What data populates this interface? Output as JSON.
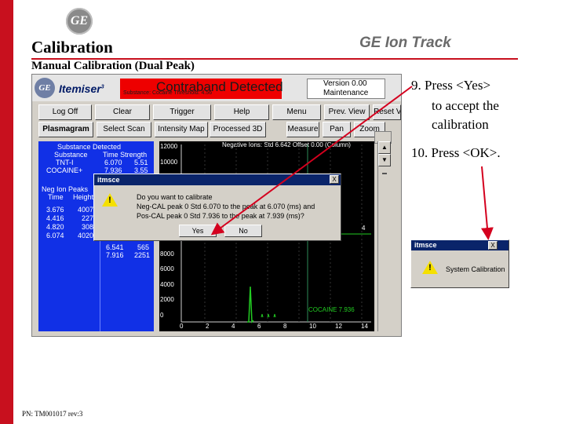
{
  "slide": {
    "logo_text": "GE",
    "title": "Calibration",
    "brand": "GE Ion Track",
    "subtitle": "Manual Calibration (Dual Peak)",
    "footer": "PN: TM001017 rev:3",
    "accent_color": "#c8101e"
  },
  "app": {
    "logo_text": "GE",
    "name": "Itemiser",
    "name_sup": "3",
    "alert_text": "Contraband Detected",
    "alert_subtext": "Substance: Cocaine Threshold: 4.56",
    "version_text": "Version 0.00",
    "mode_text": "Maintenance",
    "toolbar": [
      {
        "label": "Log Off",
        "left": 8,
        "width": 68
      },
      {
        "label": "Clear",
        "left": 80,
        "width": 70
      },
      {
        "label": "Trigger",
        "left": 154,
        "width": 74
      },
      {
        "label": "Help",
        "left": 232,
        "width": 70
      },
      {
        "label": "Menu",
        "left": 306,
        "width": 62
      },
      {
        "label": "Prev. View",
        "left": 372,
        "width": 58
      },
      {
        "label": "Reset View",
        "left": 434,
        "width": 36
      }
    ],
    "tabs": [
      {
        "label": "Plasmagram",
        "left": 8,
        "width": 70
      },
      {
        "label": "Select Scan",
        "left": 82,
        "width": 70
      },
      {
        "label": "Intensity Map",
        "left": 156,
        "width": 68
      },
      {
        "label": "Processed 3D",
        "left": 226,
        "width": 72
      },
      {
        "label": "Measure",
        "left": 324,
        "width": 42
      },
      {
        "label": "Pan",
        "left": 370,
        "width": 36
      },
      {
        "label": "Zoom",
        "left": 410,
        "width": 40
      }
    ],
    "left_panel": {
      "header": "Substance Detected",
      "col_substance": "Substance",
      "col_time_strength": "Time Strength",
      "rows": [
        {
          "substance": "TNT-I",
          "time": "6.070",
          "strength": "5.51"
        },
        {
          "substance": "COCAINE+",
          "time": "7.936",
          "strength": "3.55"
        }
      ],
      "peaks_header": "Neg Ion Peaks",
      "peaks_col_time": "Time",
      "peaks_col_height": "Height",
      "peaks": [
        {
          "time": "3.676",
          "height": "4007"
        },
        {
          "time": "4.416",
          "height": "227"
        },
        {
          "time": "4.820",
          "height": "308"
        },
        {
          "time": "6.074",
          "height": "4020"
        }
      ],
      "pos_peaks": [
        {
          "time": "6.541",
          "height": "565"
        },
        {
          "time": "7.916",
          "height": "2251"
        }
      ]
    },
    "chart_header": "Negative Ions: Std 6.642 Offset 0.00 (Column)",
    "y_ticks": [
      "12000",
      "10000",
      "8000",
      "6000",
      "4000",
      "2000",
      "10000",
      "8000",
      "6000",
      "4000",
      "2000",
      "0"
    ],
    "x_ticks": [
      "0",
      "2",
      "4",
      "6",
      "8",
      "10",
      "12",
      "14"
    ],
    "chart_label": "COCAINE 7.936",
    "chart_side_number": "4",
    "dialog": {
      "title": "itmsce",
      "close": "X",
      "line1": "Do you want to calibrate",
      "line2": "Neg-CAL peak 0 Std 6.070 to the peak at 6.070 (ms) and",
      "line3": "Pos-CAL peak 0 Std 7.936 to the peak at 7.939 (ms)?",
      "yes": "Yes",
      "no": "No"
    }
  },
  "steps": {
    "s9_line1": "9. Press <Yes>",
    "s9_line2": "to accept the",
    "s9_line3": "calibration",
    "s10": "10. Press <OK>."
  },
  "dialog2": {
    "title": "itmsce",
    "close": "X",
    "text": "System Calibration"
  }
}
